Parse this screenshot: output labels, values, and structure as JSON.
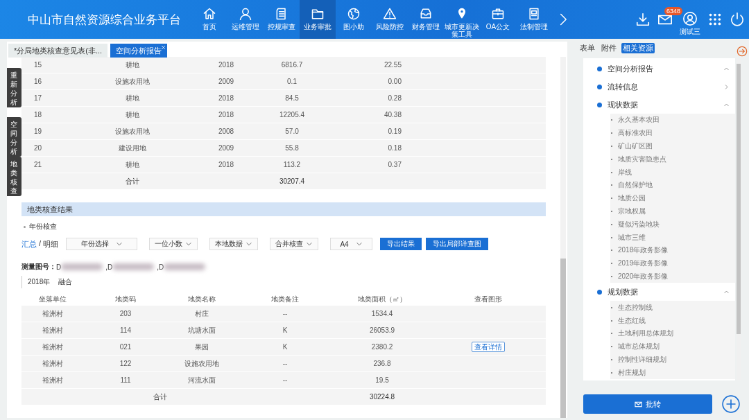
{
  "header": {
    "title": "中山市自然资源综合业务平台",
    "nav": [
      {
        "label": "首页",
        "selected": false
      },
      {
        "label": "运维管理",
        "selected": false
      },
      {
        "label": "控规审查",
        "selected": false
      },
      {
        "label": "业务审批",
        "selected": true
      },
      {
        "label": "图小助",
        "selected": false
      },
      {
        "label": "风险防控",
        "selected": false
      },
      {
        "label": "财务管理",
        "selected": false
      },
      {
        "label": "城市更新决策工具",
        "selected": false
      },
      {
        "label": "OA公文",
        "selected": false
      },
      {
        "label": "法制管理",
        "selected": false
      }
    ],
    "mail_badge": "6348",
    "user": "测试三"
  },
  "doc_tabs": [
    {
      "label": "*分局地类核查意见表(非...",
      "selected": false,
      "closable": false
    },
    {
      "label": "空间分析报告",
      "selected": true,
      "closable": true
    }
  ],
  "side_tabs": [
    "重新分析",
    "空间分析",
    "地类核查"
  ],
  "top_table": {
    "rows": [
      [
        "15",
        "耕地",
        "2018",
        "6816.7",
        "22.55"
      ],
      [
        "16",
        "设施农用地",
        "2009",
        "0.1",
        "0.00"
      ],
      [
        "17",
        "耕地",
        "2018",
        "84.5",
        "0.28"
      ],
      [
        "18",
        "耕地",
        "2018",
        "12205.4",
        "40.38"
      ],
      [
        "19",
        "设施农用地",
        "2008",
        "57.0",
        "0.19"
      ],
      [
        "20",
        "建设用地",
        "2009",
        "55.8",
        "0.18"
      ],
      [
        "21",
        "耕地",
        "2018",
        "113.2",
        "0.37"
      ]
    ],
    "total": {
      "label": "合计",
      "value": "30207.4"
    }
  },
  "section": {
    "title": "地类核查结果",
    "subtitle": "年份核查",
    "view_toggle": [
      {
        "label": "汇总",
        "selected": true
      },
      {
        "label": "明细",
        "selected": false
      }
    ],
    "toggle_separator": "/",
    "selects": [
      "年份选择",
      "一位小数",
      "本地数据",
      "合并核查",
      "A4"
    ],
    "buttons": [
      "导出结果",
      "导出局部详查图"
    ],
    "sheet_label": "测量图号：",
    "sheet_parts": [
      "D",
      ",D",
      ",D"
    ],
    "year": "2018年",
    "mode": "融合",
    "columns": [
      "坐落单位",
      "地类码",
      "地类名称",
      "地类备注",
      "地类面积（㎡）",
      "查看图形"
    ],
    "rows": [
      {
        "cells": [
          "裕洲村",
          "203",
          "村庄",
          "--",
          "1534.4"
        ]
      },
      {
        "cells": [
          "裕洲村",
          "114",
          "坑塘水面",
          "K",
          "26053.9"
        ]
      },
      {
        "cells": [
          "裕洲村",
          "021",
          "果园",
          "K",
          "2380.2"
        ],
        "action": "查看详情"
      },
      {
        "cells": [
          "裕洲村",
          "122",
          "设施农用地",
          "--",
          "236.8"
        ]
      },
      {
        "cells": [
          "裕洲村",
          "111",
          "河流水面",
          "--",
          "19.5"
        ]
      }
    ],
    "total": {
      "label": "合计",
      "value": "30224.8"
    }
  },
  "right_tabs": [
    {
      "label": "表单",
      "selected": false
    },
    {
      "label": "附件",
      "selected": false
    },
    {
      "label": "相关资源",
      "selected": true
    }
  ],
  "tree": [
    {
      "label": "空间分析报告",
      "expanded": true
    },
    {
      "label": "流转信息",
      "expanded": false
    },
    {
      "label": "现状数据",
      "expanded": true,
      "children": [
        "永久基本农田",
        "高标准农田",
        "矿山矿区图",
        "地质灾害隐患点",
        "岸线",
        "自然保护地",
        "地质公园",
        "宗地权属",
        "疑似污染地块",
        "城市三维",
        "2018年政务影像",
        "2019年政务影像",
        "2020年政务影像"
      ]
    },
    {
      "label": "规划数据",
      "expanded": true,
      "children": [
        "生态控制线",
        "生态红线",
        "土地利用总体规划",
        "城市总体规划",
        "控制性详细规划",
        "村庄规划"
      ]
    }
  ],
  "forward_button": "批转"
}
